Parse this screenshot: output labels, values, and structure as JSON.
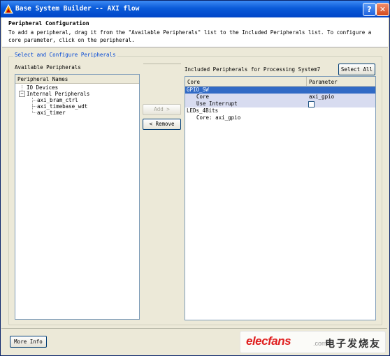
{
  "window": {
    "title": "Base System Builder -- AXI flow",
    "help_glyph": "?",
    "close_glyph": "✕"
  },
  "header": {
    "title": "Peripheral Configuration",
    "description": "To add a peripheral, drag it from the \"Available Peripherals\" list to the Included Peripherals list. To configure a core parameter, click on the peripheral."
  },
  "group": {
    "legend": "Select and Configure Peripherals"
  },
  "available": {
    "label": "Available Peripherals",
    "column_header": "Peripheral Names",
    "tree": [
      {
        "label": "IO Devices",
        "expander": "+"
      },
      {
        "label": "Internal Peripherals",
        "expander": "−"
      },
      {
        "label": "axi_bram_ctrl"
      },
      {
        "label": "axi_timebase_wdt"
      },
      {
        "label": "axi_timer"
      }
    ]
  },
  "buttons": {
    "add": "Add >",
    "remove": "< Remove",
    "select_all": "Select All",
    "more_info": "More Info"
  },
  "included": {
    "label": "Included Peripherals for Processing System7",
    "columns": [
      "Core",
      "Parameter"
    ],
    "rows": [
      {
        "core": "GPIO_SW",
        "param": ""
      },
      {
        "core": "Core",
        "param": "axi_gpio"
      },
      {
        "core": "Use Interrupt",
        "param": ""
      },
      {
        "core": "LEDs_4Bits",
        "param": ""
      },
      {
        "core": "Core: axi_gpio",
        "param": ""
      }
    ]
  },
  "watermark": {
    "logo": "elecfans",
    "com": ".com",
    "chinese": "电子发烧友"
  },
  "colors": {
    "titlebar": "#0a5ad8",
    "selection": "#316ac5",
    "legend": "#0046d5",
    "watermark_logo": "#e02020"
  }
}
